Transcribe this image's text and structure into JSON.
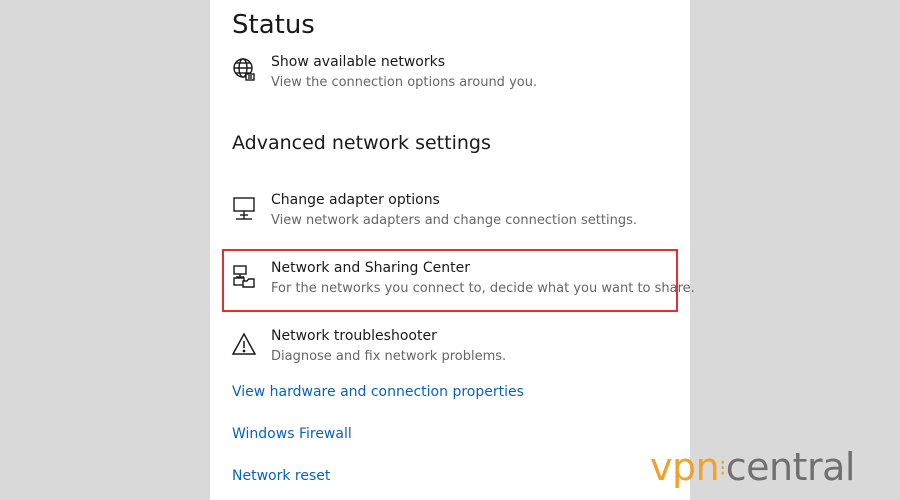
{
  "status": {
    "heading": "Status",
    "show_networks": {
      "title": "Show available networks",
      "description": "View the connection options around you.",
      "icon": "globe-icon"
    }
  },
  "advanced": {
    "heading": "Advanced network settings",
    "items": [
      {
        "title": "Change adapter options",
        "description": "View network adapters and change connection settings.",
        "icon": "monitor-network-icon"
      },
      {
        "title": "Network and Sharing Center",
        "description": "For the networks you connect to, decide what you want to share.",
        "icon": "sharing-center-icon"
      },
      {
        "title": "Network troubleshooter",
        "description": "Diagnose and fix network problems.",
        "icon": "warning-icon"
      }
    ]
  },
  "links": [
    "View hardware and connection properties",
    "Windows Firewall",
    "Network reset"
  ],
  "watermark": {
    "part1": "vpn",
    "part2": "central"
  },
  "colors": {
    "link": "#0a62b8",
    "highlight": "#e03030",
    "watermark_accent": "#f0a22d"
  }
}
